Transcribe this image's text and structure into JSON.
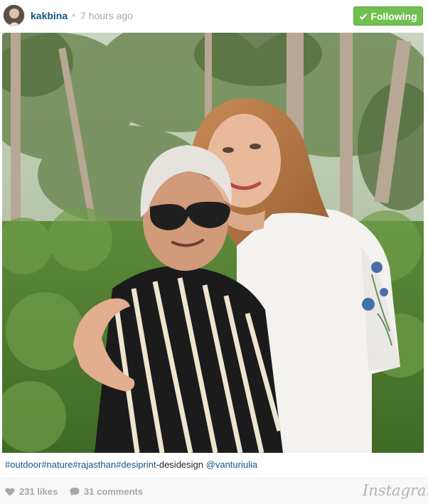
{
  "header": {
    "username": "kakbina",
    "separator": "•",
    "timestamp": "7 hours ago",
    "follow_label": "Following",
    "follow_color": "#70c050"
  },
  "post": {
    "caption_tags": [
      "#outdoor",
      "#nature",
      "#rajasthan",
      "#desiprint"
    ],
    "caption_text": "-desidesign",
    "caption_mention": "@vanturiulia"
  },
  "footer": {
    "likes": "231 likes",
    "comments": "31 comments",
    "brand": "Instagram"
  },
  "icons": {
    "check": "check-icon",
    "heart": "heart-icon",
    "comment": "comment-bubble-icon"
  },
  "colors": {
    "link": "#125688",
    "muted": "#a5a7aa",
    "follow": "#70c050"
  }
}
